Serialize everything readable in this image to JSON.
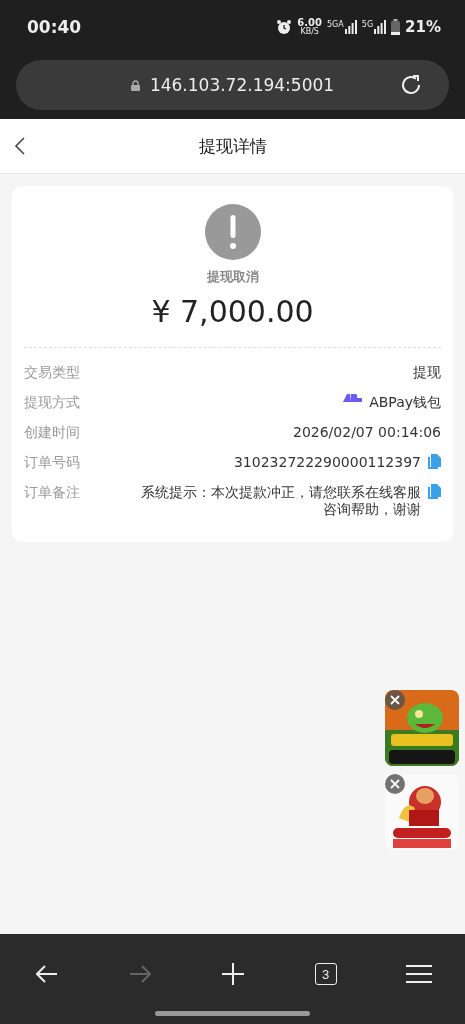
{
  "status_bar": {
    "time": "00:40",
    "net_speed": "6.00",
    "net_unit": "KB/S",
    "signals": [
      "5GA",
      "5G"
    ],
    "battery": "21%"
  },
  "address_bar": {
    "url": "146.103.72.194:5001"
  },
  "header": {
    "title": "提现详情"
  },
  "status": {
    "label": "提现取消",
    "amount": "¥ 7,000.00"
  },
  "details": [
    {
      "kind": "plain",
      "label": "交易类型",
      "value": "提现"
    },
    {
      "kind": "wallet",
      "label": "提现方式",
      "value": "ABPay钱包"
    },
    {
      "kind": "plain",
      "label": "创建时间",
      "value": "2026/02/07 00:14:06"
    },
    {
      "kind": "copyable",
      "label": "订单号码",
      "value": "310232722290000112397"
    },
    {
      "kind": "copyable",
      "label": "订单备注",
      "value": "系统提示：本次提款冲正，请您联系在线客服咨询帮助，谢谢"
    }
  ],
  "floating_ads": [
    {
      "kind": "picture",
      "closable": true
    },
    {
      "kind": "picture",
      "closable": true
    }
  ],
  "bottom_nav": [
    {
      "kind": "back",
      "disabled": false
    },
    {
      "kind": "forward",
      "disabled": true
    },
    {
      "kind": "new-tab",
      "disabled": false
    },
    {
      "kind": "tabs",
      "count": "3",
      "disabled": false
    },
    {
      "kind": "menu",
      "disabled": false
    }
  ]
}
